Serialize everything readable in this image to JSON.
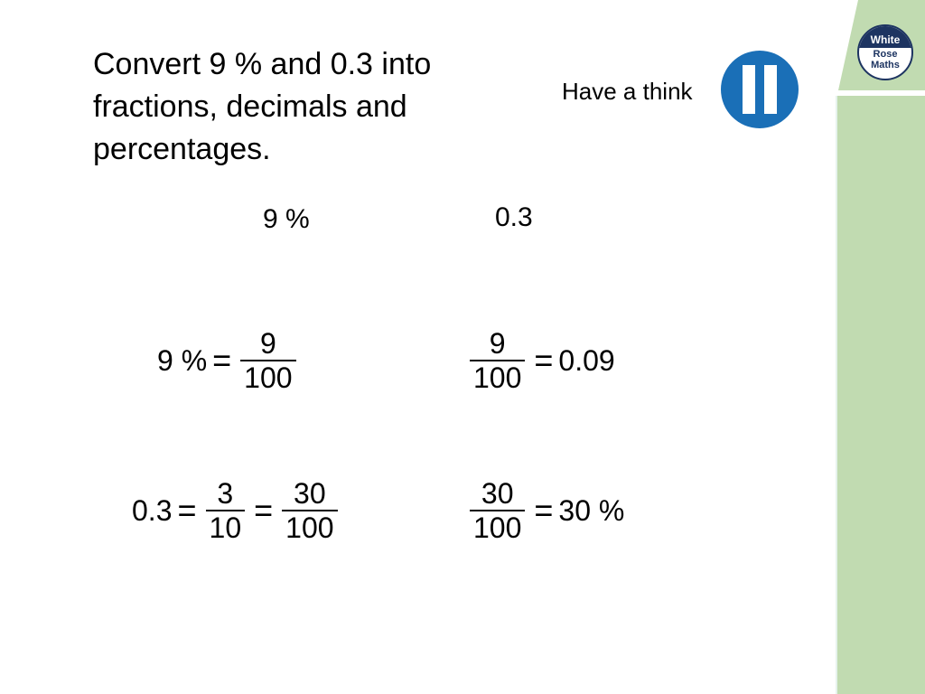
{
  "slide": {
    "title_lines": [
      "Convert 9 % and 0.3 into",
      "fractions, decimals and",
      "percentages."
    ],
    "prompt": "Have a think",
    "pause_icon": "pause-icon",
    "logo": {
      "line1": "White",
      "line2": "Rose",
      "line3": "Maths"
    },
    "colors": {
      "sidebar": "#c1dbb1",
      "pause": "#1a6fb7",
      "logo": "#1d3461"
    },
    "labels": {
      "left": "9 %",
      "right": "0.3"
    },
    "eq1": {
      "lhs": "9 %",
      "eq": "=",
      "num": "9",
      "den": "100"
    },
    "eq2": {
      "num": "9",
      "den": "100",
      "eq": "=",
      "rhs": "0.09"
    },
    "eq3": {
      "lhs": "0.3",
      "eq": "=",
      "num1": "3",
      "den1": "10",
      "eq2": "=",
      "num2": "30",
      "den2": "100"
    },
    "eq4": {
      "num": "30",
      "den": "100",
      "eq": "=",
      "rhs": "30 %"
    }
  }
}
